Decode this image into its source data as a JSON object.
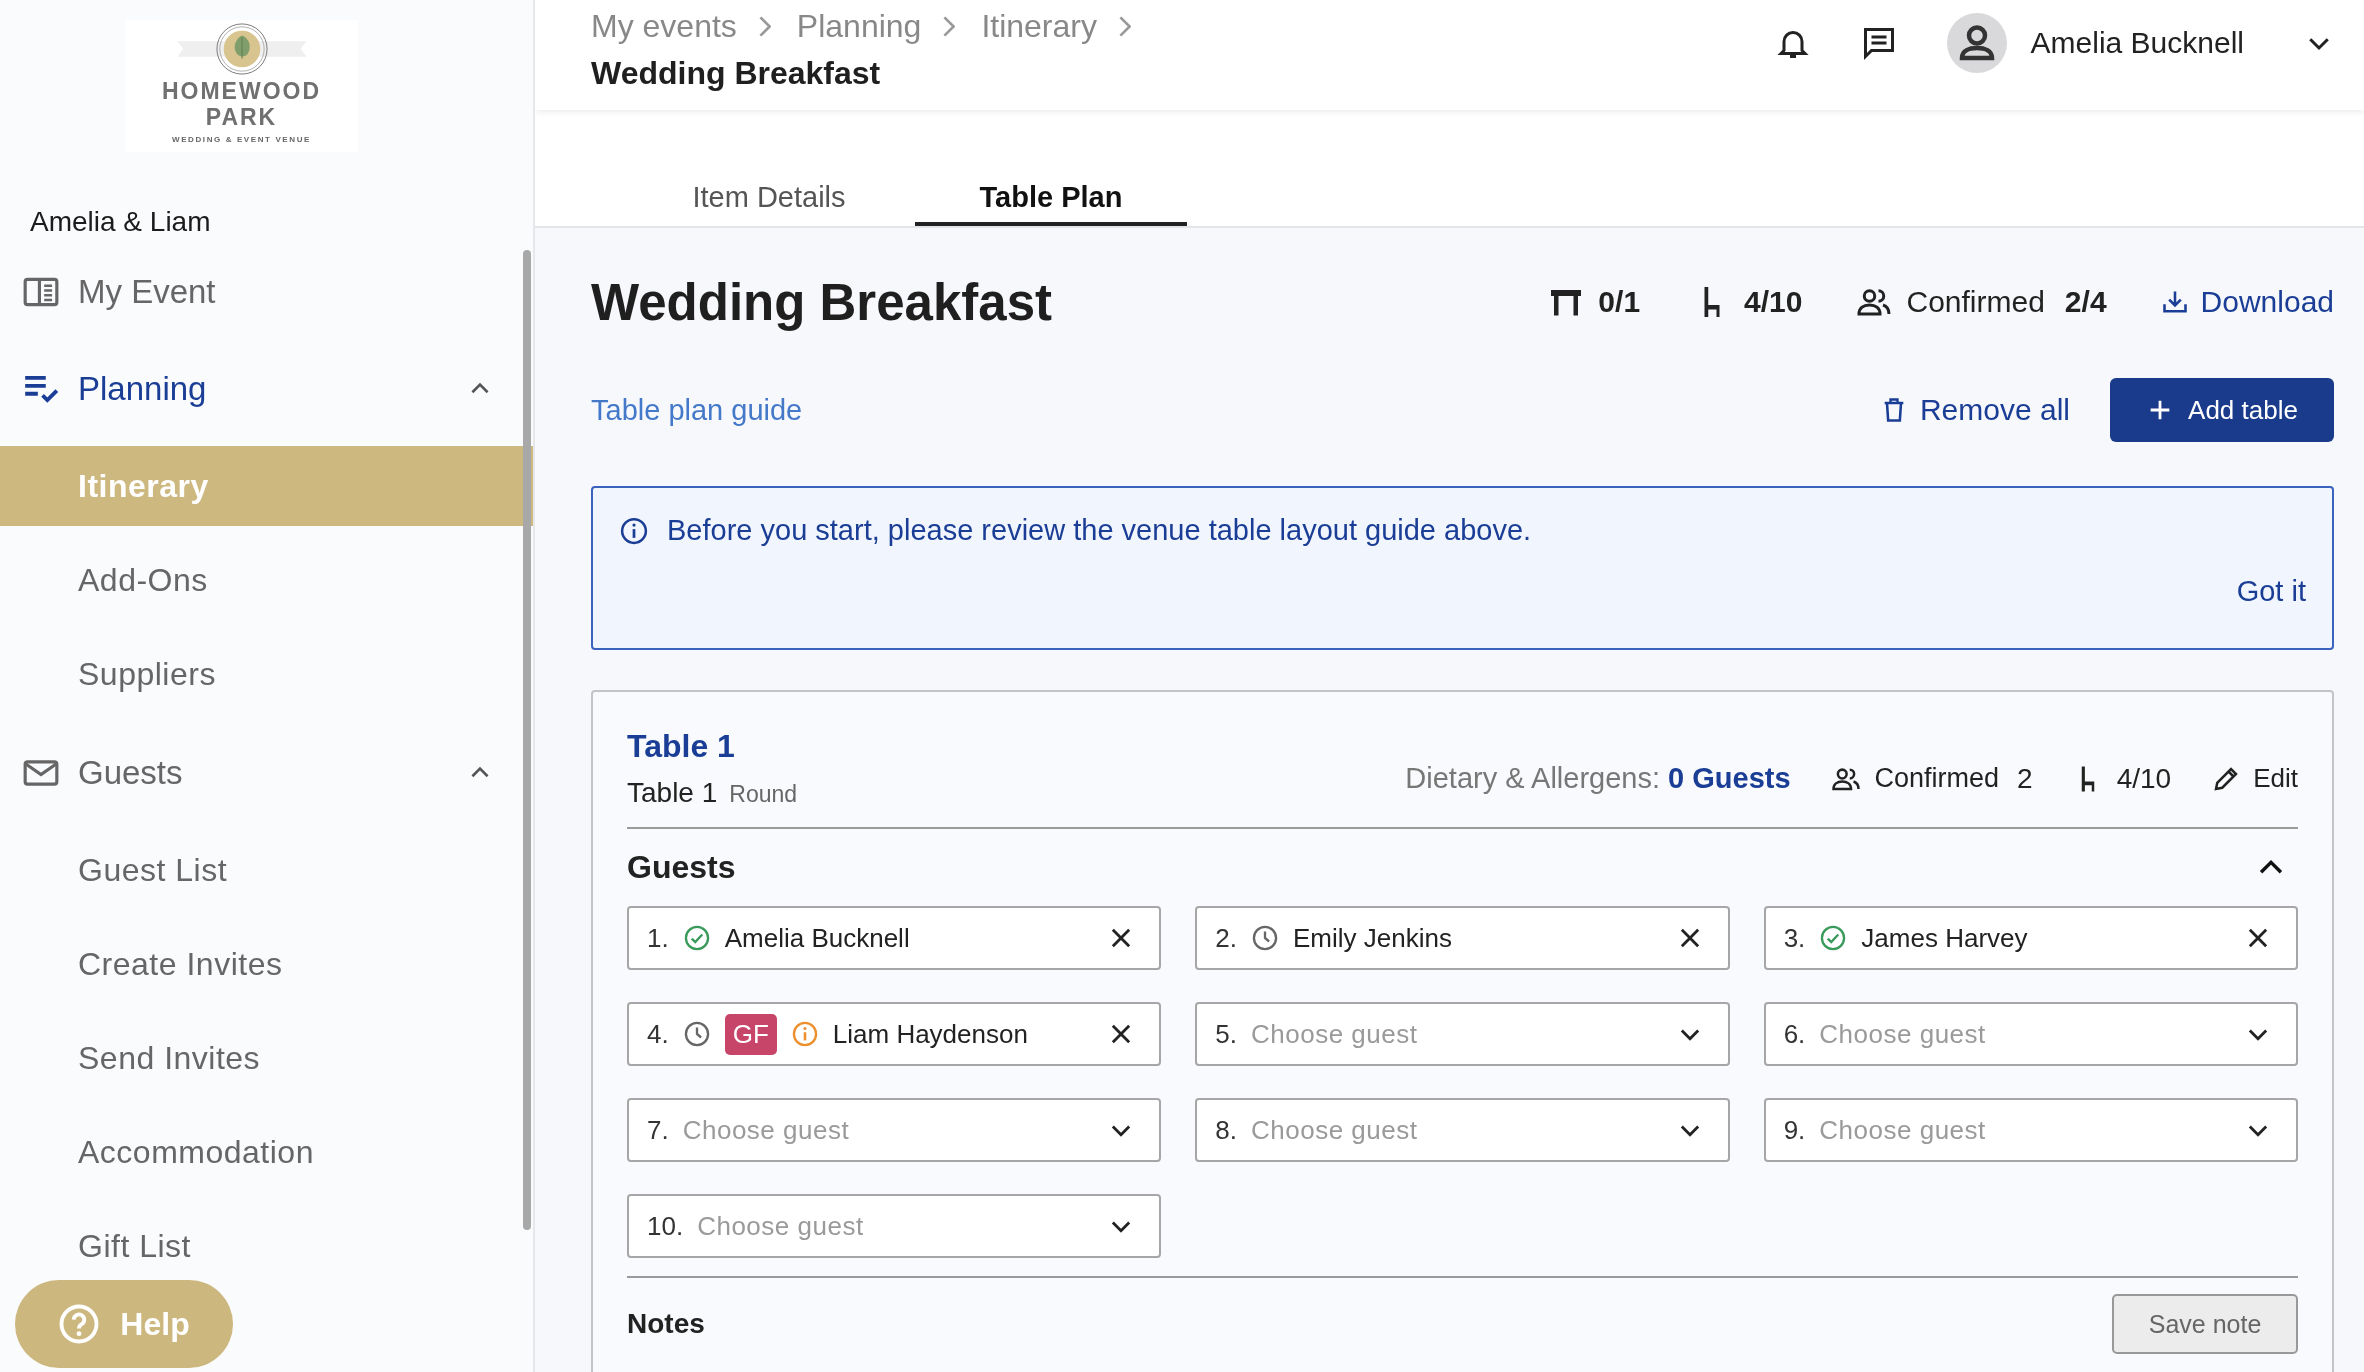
{
  "logo": {
    "wordmark": "HOMEWOOD PARK",
    "tagline": "WEDDING & EVENT VENUE"
  },
  "sidebar": {
    "event_name": "Amelia & Liam",
    "items": [
      {
        "label": "My Event",
        "kind": "link",
        "selected": false
      },
      {
        "label": "Planning",
        "kind": "group",
        "selected": true,
        "expanded": true,
        "children": [
          {
            "label": "Itinerary",
            "selected": true
          },
          {
            "label": "Add-Ons",
            "selected": false
          },
          {
            "label": "Suppliers",
            "selected": false
          }
        ]
      },
      {
        "label": "Guests",
        "kind": "group",
        "selected": false,
        "expanded": true,
        "children": [
          {
            "label": "Guest List",
            "selected": false
          },
          {
            "label": "Create Invites",
            "selected": false
          },
          {
            "label": "Send Invites",
            "selected": false
          },
          {
            "label": "Accommodation",
            "selected": false
          },
          {
            "label": "Gift List",
            "selected": false
          }
        ]
      }
    ]
  },
  "help_button": {
    "label": "Help"
  },
  "header": {
    "breadcrumbs": [
      "My events",
      "Planning",
      "Itinerary"
    ],
    "title": "Wedding Breakfast",
    "user": {
      "name": "Amelia Bucknell"
    }
  },
  "tabs": [
    {
      "label": "Item Details",
      "selected": false
    },
    {
      "label": "Table Plan",
      "selected": true
    }
  ],
  "plan": {
    "title": "Wedding Breakfast",
    "tables": "0/1",
    "seats": "4/10",
    "confirmed_label": "Confirmed",
    "confirmed": "2/4",
    "download": "Download",
    "guide_link": "Table plan guide",
    "remove_all": "Remove all",
    "add_table": "Add table"
  },
  "notice": {
    "text": "Before you start, please review the venue table layout guide above.",
    "dismiss": "Got it"
  },
  "table": {
    "title": "Table 1",
    "name": "Table 1",
    "shape": "Round",
    "dietary_label": "Dietary & Allergens:",
    "dietary_value": "0 Guests",
    "confirmed_label": "Confirmed",
    "confirmed": "2",
    "seats": "4/10",
    "edit": "Edit",
    "guests_heading": "Guests",
    "expanded": true,
    "guests": [
      {
        "kind": "filled",
        "number": "1.",
        "name": "Amelia Bucknell",
        "confirmed": true
      },
      {
        "kind": "filled",
        "number": "2.",
        "name": "Emily Jenkins",
        "confirmed": false
      },
      {
        "kind": "filled",
        "number": "3.",
        "name": "James Harvey",
        "confirmed": true
      },
      {
        "kind": "filled",
        "number": "4.",
        "name": "Liam Haydenson",
        "confirmed": false,
        "tags": [
          {
            "label": "GF",
            "color": "#c8456a"
          }
        ],
        "warning": true
      },
      {
        "kind": "empty",
        "number": "5.",
        "placeholder": "Choose guest"
      },
      {
        "kind": "empty",
        "number": "6.",
        "placeholder": "Choose guest"
      },
      {
        "kind": "empty",
        "number": "7.",
        "placeholder": "Choose guest"
      },
      {
        "kind": "empty",
        "number": "8.",
        "placeholder": "Choose guest"
      },
      {
        "kind": "empty",
        "number": "9.",
        "placeholder": "Choose guest"
      },
      {
        "kind": "empty",
        "number": "10.",
        "placeholder": "Choose guest"
      }
    ],
    "notes_heading": "Notes",
    "save_note": {
      "label": "Save note",
      "disabled": true
    }
  }
}
